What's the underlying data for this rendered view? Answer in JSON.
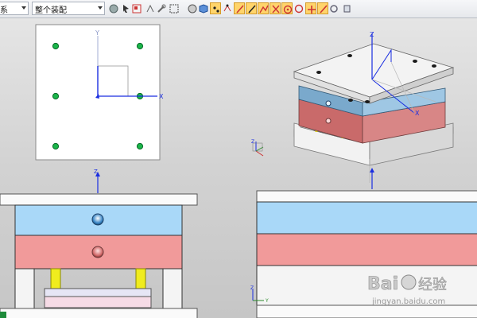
{
  "toolbar": {
    "combo_left": "系",
    "combo_assembly": "整个装配",
    "icons": [
      "palette-icon",
      "select-icon",
      "snap-icon",
      "arrow-icon",
      "wrench-icon",
      "box-select-icon",
      "sphere-icon",
      "cube-icon",
      "point-icon",
      "vertex-icon",
      "line-icon",
      "curve-icon",
      "face-icon",
      "intersect-icon",
      "center-icon",
      "crosshair-icon",
      "plus-icon",
      "slash-icon",
      "settings-icon",
      "layer-icon"
    ]
  },
  "views": {
    "top_view": {
      "axis_x": "X",
      "axis_y": "Y"
    },
    "iso_view": {
      "axis_x": "X",
      "axis_y": "Y",
      "axis_z": "Z"
    },
    "front_view": {
      "axis_z": "Z"
    },
    "side_view": {
      "axis_x": "X",
      "axis_y": "Y",
      "axis_z": "Z"
    }
  },
  "colors": {
    "plate_blue": "#a9d8f8",
    "plate_red": "#f19a9a",
    "plate_white": "#f4f4f4",
    "pin_yellow": "#f0ec1e",
    "hole_green": "#22a845",
    "axis_blue": "#1a2ee0",
    "toolbar_active": "#ffd46b"
  },
  "watermark": {
    "brand": "Bai",
    "brand2": "经验",
    "url": "jingyan.baidu.com"
  }
}
